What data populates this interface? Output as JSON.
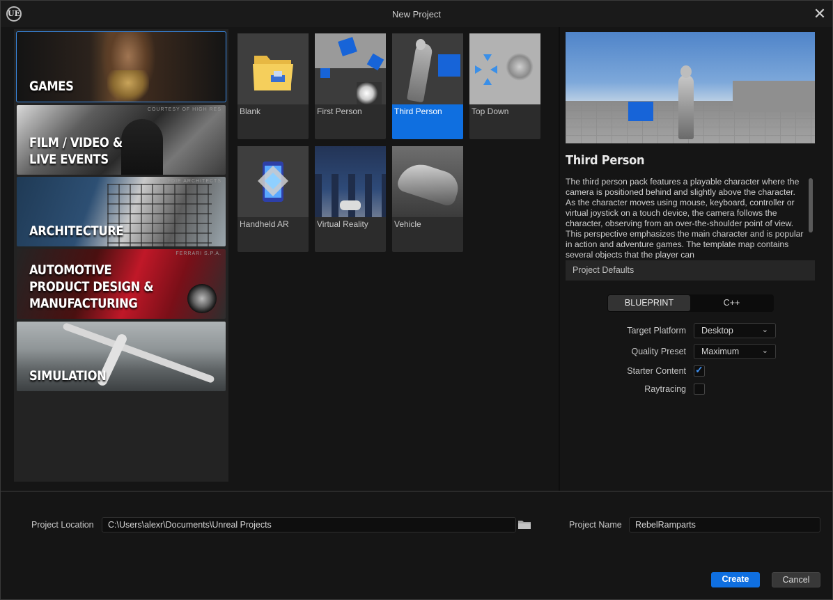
{
  "window": {
    "title": "New Project",
    "logo": "UE"
  },
  "categories": [
    {
      "label": "GAMES",
      "credit": ""
    },
    {
      "label": "FILM / VIDEO &\nLIVE EVENTS",
      "credit": "COURTESY OF HIGH RES"
    },
    {
      "label": "ARCHITECTURE",
      "credit": "SAFDIE ARCHITECTS"
    },
    {
      "label": "AUTOMOTIVE\nPRODUCT DESIGN &\nMANUFACTURING",
      "credit": "FERRARI S.P.A."
    },
    {
      "label": "SIMULATION",
      "credit": ""
    }
  ],
  "templates": [
    {
      "name": "Blank"
    },
    {
      "name": "First Person"
    },
    {
      "name": "Third Person"
    },
    {
      "name": "Top Down"
    },
    {
      "name": "Handheld AR"
    },
    {
      "name": "Virtual Reality"
    },
    {
      "name": "Vehicle"
    }
  ],
  "detail": {
    "title": "Third Person",
    "description": "The third person pack features a playable character where the camera is positioned behind and slightly above the character. As the character moves using mouse, keyboard, controller or virtual joystick on a touch device, the camera follows the character, observing from an over-the-shoulder point of view. This perspective emphasizes the main character and is popular in action and adventure games. The template map contains several objects that the player can"
  },
  "defaults": {
    "header": "Project Defaults",
    "blueprint_label": "BLUEPRINT",
    "cpp_label": "C++",
    "target_platform_label": "Target Platform",
    "target_platform_value": "Desktop",
    "quality_preset_label": "Quality Preset",
    "quality_preset_value": "Maximum",
    "starter_content_label": "Starter Content",
    "raytracing_label": "Raytracing"
  },
  "bottom": {
    "location_label": "Project Location",
    "location_value": "C:\\Users\\alexr\\Documents\\Unreal Projects",
    "name_label": "Project Name",
    "name_value": "RebelRamparts",
    "create_label": "Create",
    "cancel_label": "Cancel"
  },
  "colors": {
    "accent": "#0f6fe0",
    "background": "#151515",
    "panel": "#232323"
  }
}
